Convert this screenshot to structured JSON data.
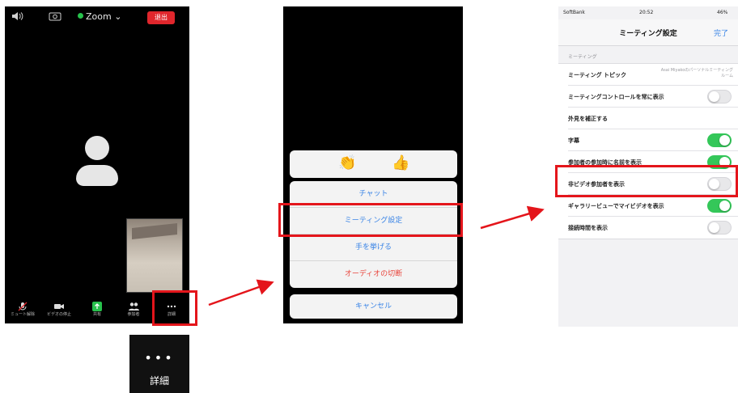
{
  "colors": {
    "highlight": "#e4151b",
    "leave_button": "#e0262c",
    "ios_blue": "#3a84e6",
    "ios_red": "#e8453c",
    "toggle_on": "#34c759",
    "zoom_green": "#27c24c"
  },
  "meeting_screen": {
    "top_bar": {
      "speaker_icon": "speaker-icon",
      "camera_switch_icon": "camera-switch-icon",
      "app_label": "Zoom ⌄",
      "leave_label": "退出"
    },
    "bottom_bar": [
      {
        "icon": "mic-muted-icon",
        "label": "ミュート解除"
      },
      {
        "icon": "video-camera-icon",
        "label": "ビデオの停止"
      },
      {
        "icon": "share-icon",
        "label": "共有"
      },
      {
        "icon": "participants-icon",
        "label": "参加者"
      },
      {
        "icon": "more-icon",
        "label": "詳細"
      }
    ]
  },
  "details_zoom": {
    "dots": "•••",
    "label": "詳細"
  },
  "action_sheet": {
    "reactions": [
      "👏",
      "👍"
    ],
    "items": [
      {
        "label": "チャット",
        "style": "normal"
      },
      {
        "label": "ミーティング設定",
        "style": "normal"
      },
      {
        "label": "手を挙げる",
        "style": "normal"
      },
      {
        "label": "オーディオの切断",
        "style": "danger"
      }
    ],
    "cancel_label": "キャンセル"
  },
  "settings_screen": {
    "status_bar": {
      "carrier": "SoftBank",
      "time": "20:52",
      "battery": "46%"
    },
    "title": "ミーティング設定",
    "done_label": "完了",
    "section_header": "ミーティング",
    "rows": [
      {
        "label": "ミーティング トピック",
        "value": "Asai Miyakoのパーソナルミーティングルーム",
        "toggle": null
      },
      {
        "label": "ミーティングコントロールを常に表示",
        "value": "",
        "toggle": "off"
      },
      {
        "label": "外見を補正する",
        "value": "",
        "toggle": null
      },
      {
        "label": "字幕",
        "value": "",
        "toggle": "on"
      },
      {
        "label": "参加者の参加時に名前を表示",
        "value": "",
        "toggle": "on"
      },
      {
        "label": "非ビデオ参加者を表示",
        "value": "",
        "toggle": "off"
      },
      {
        "label": "ギャラリービューでマイビデオを表示",
        "value": "",
        "toggle": "on"
      },
      {
        "label": "接続時間を表示",
        "value": "",
        "toggle": "off"
      }
    ]
  }
}
